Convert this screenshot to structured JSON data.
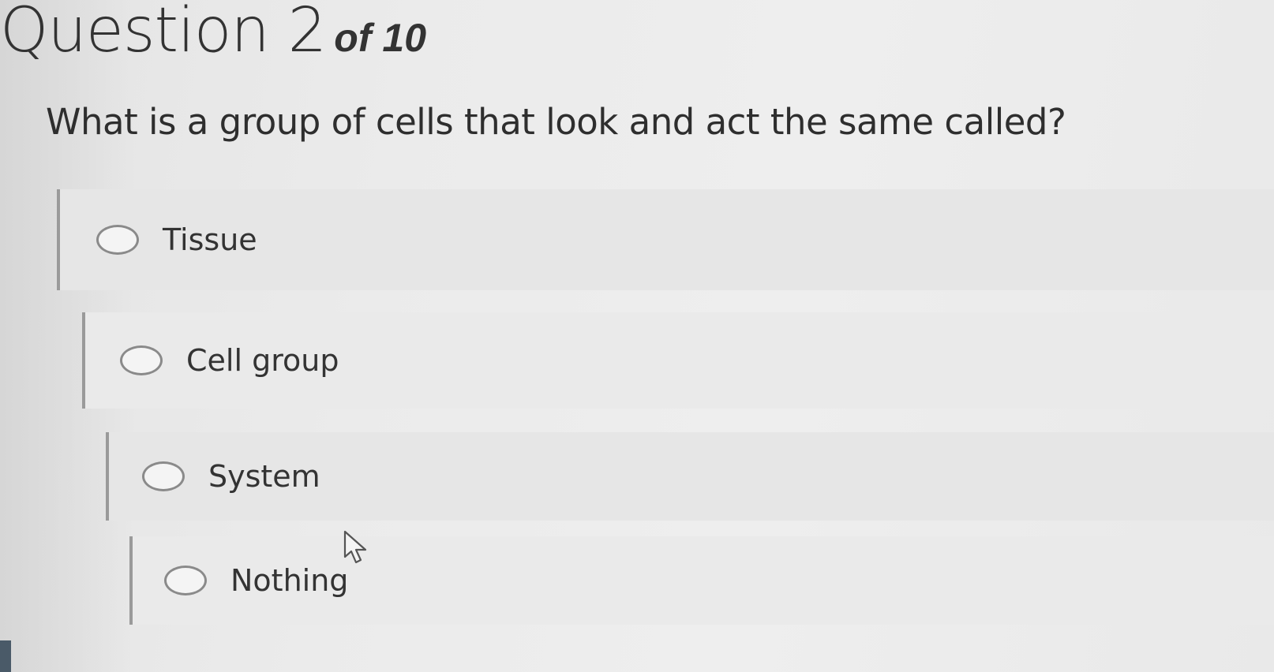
{
  "quiz": {
    "question_word": "Question 2",
    "question_count": "of 10",
    "prompt": "What is a group of cells that look and act the same called?",
    "options": [
      {
        "label": "Tissue"
      },
      {
        "label": "Cell group"
      },
      {
        "label": "System"
      },
      {
        "label": "Nothing"
      }
    ]
  }
}
